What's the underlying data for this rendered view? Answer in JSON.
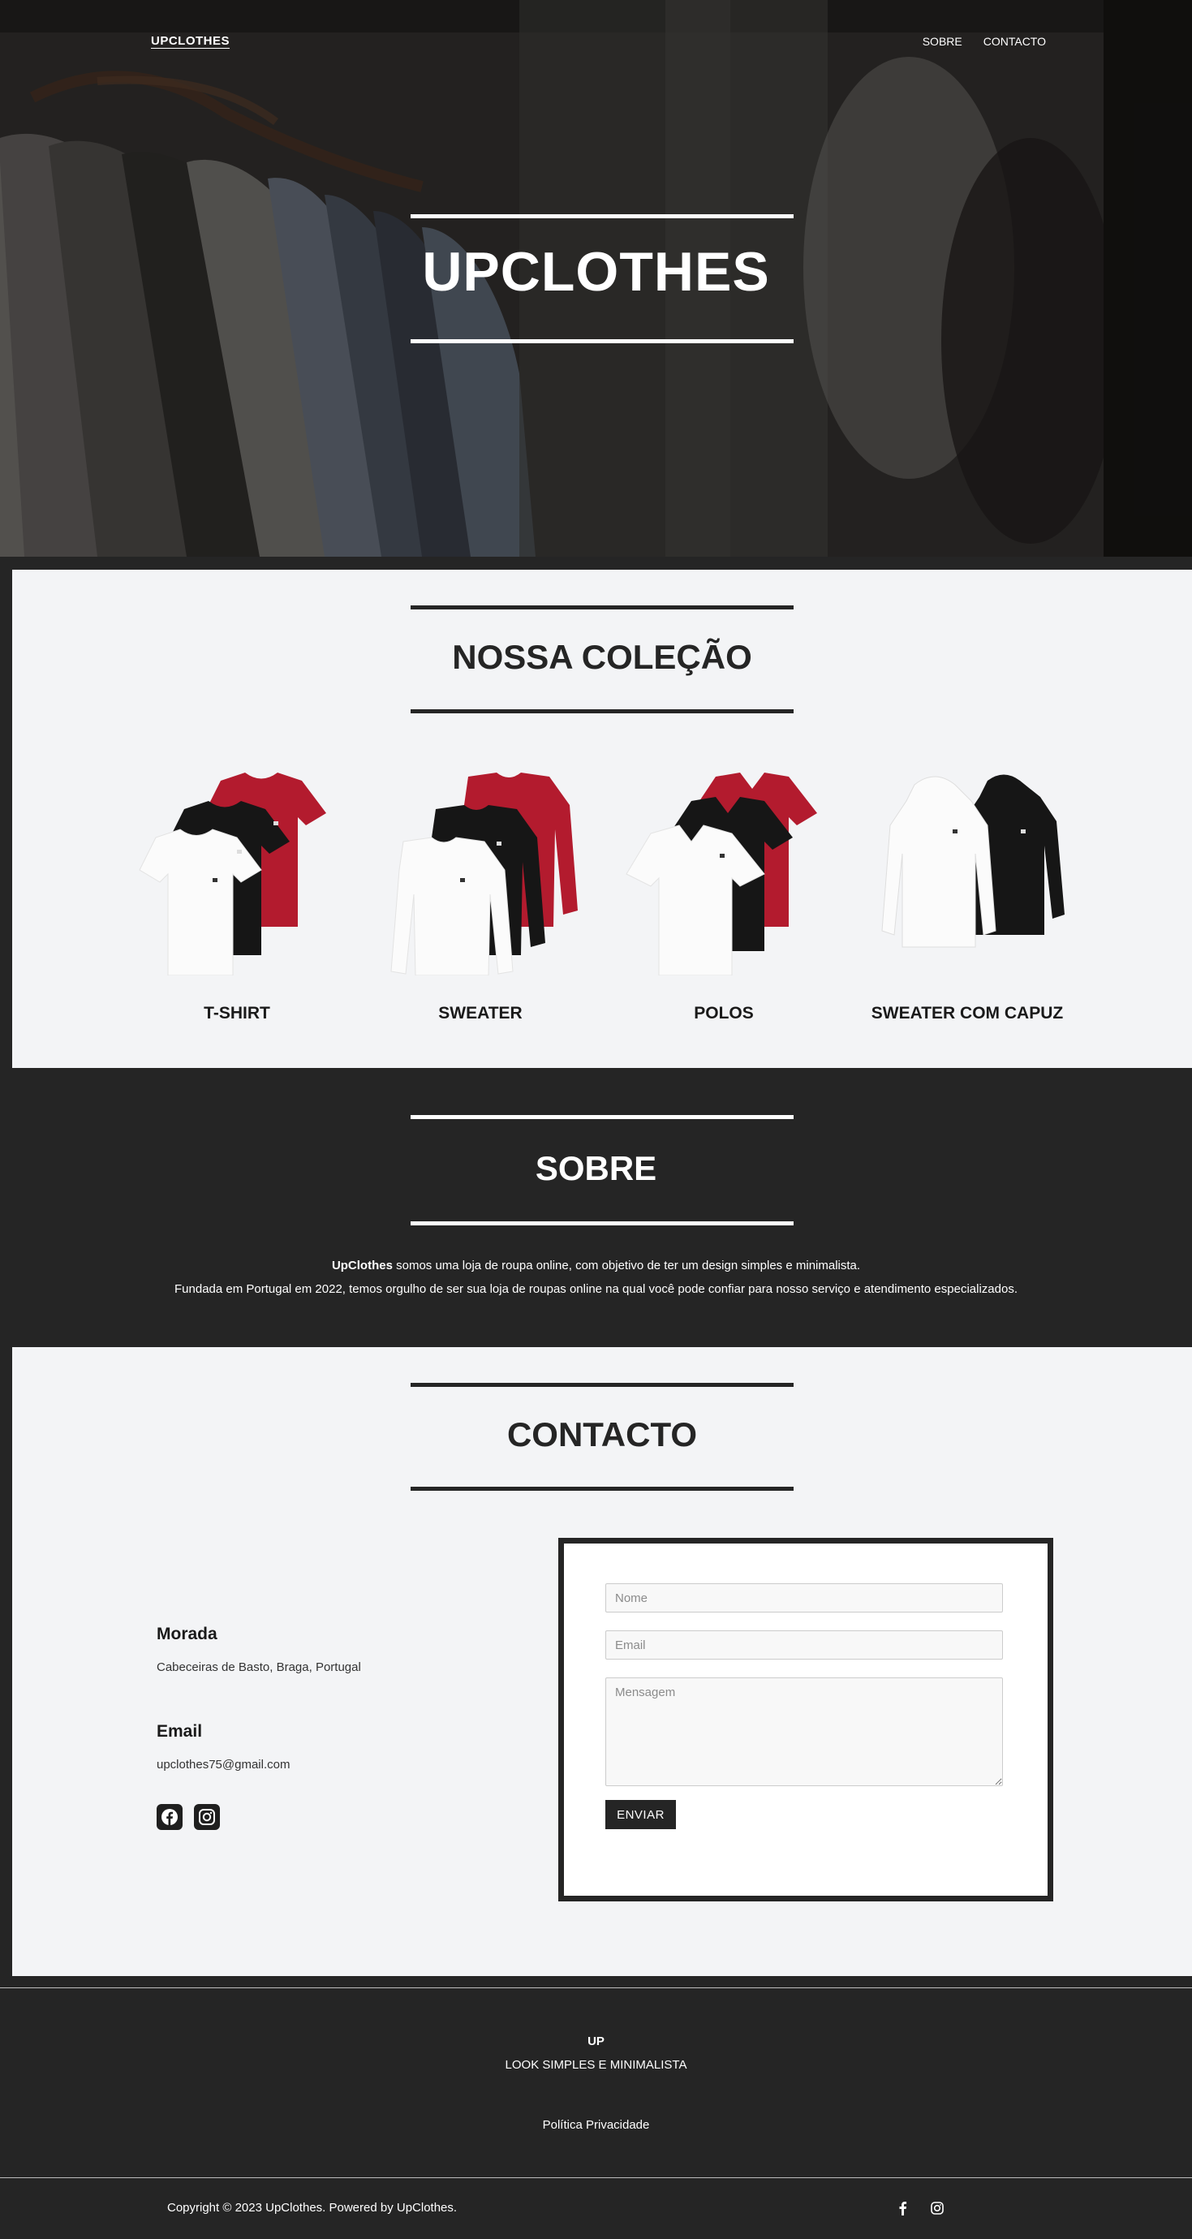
{
  "nav": {
    "logo": "UPCLOTHES",
    "links": [
      "SOBRE",
      "CONTACTO"
    ]
  },
  "hero": {
    "title": "UPCLOTHES"
  },
  "collection": {
    "title": "NOSSA COLEÇÃO",
    "products": [
      {
        "label": "T-SHIRT",
        "colors": [
          "#ffffff",
          "#1a1a1a",
          "#b31b2e"
        ]
      },
      {
        "label": "SWEATER",
        "colors": [
          "#ffffff",
          "#1a1a1a",
          "#b31b2e"
        ]
      },
      {
        "label": "POLOS",
        "colors": [
          "#ffffff",
          "#1a1a1a",
          "#b31b2e"
        ]
      },
      {
        "label": "SWEATER COM CAPUZ",
        "colors": [
          "#ffffff",
          "#1a1a1a"
        ]
      }
    ]
  },
  "sobre": {
    "title": "SOBRE",
    "brand": "UpClothes",
    "line1_rest": " somos uma loja de roupa online, com objetivo de ter um design simples e minimalista.",
    "line2": "Fundada em Portugal em 2022, temos orgulho de ser sua loja de roupas online na qual você pode confiar para nosso serviço e atendimento especializados."
  },
  "contacto": {
    "title": "CONTACTO",
    "address_heading": "Morada",
    "address": "Cabeceiras de Basto, Braga, Portugal",
    "email_heading": "Email",
    "email": "upclothes75@gmail.com",
    "social_icons": [
      "facebook-icon",
      "instagram-icon"
    ],
    "form": {
      "name_placeholder": "Nome",
      "email_placeholder": "Email",
      "message_placeholder": "Mensagem",
      "submit": "ENVIAR"
    }
  },
  "footer": {
    "brand": "UP",
    "tagline": "LOOK SIMPLES E MINIMALISTA",
    "privacy": "Política Privacidade",
    "copyright": "Copyright © 2023 UpClothes. Powered by UpClothes."
  },
  "colors": {
    "dark": "#252525",
    "light_bg": "#f3f4f6",
    "accent_red": "#b31b2e"
  }
}
